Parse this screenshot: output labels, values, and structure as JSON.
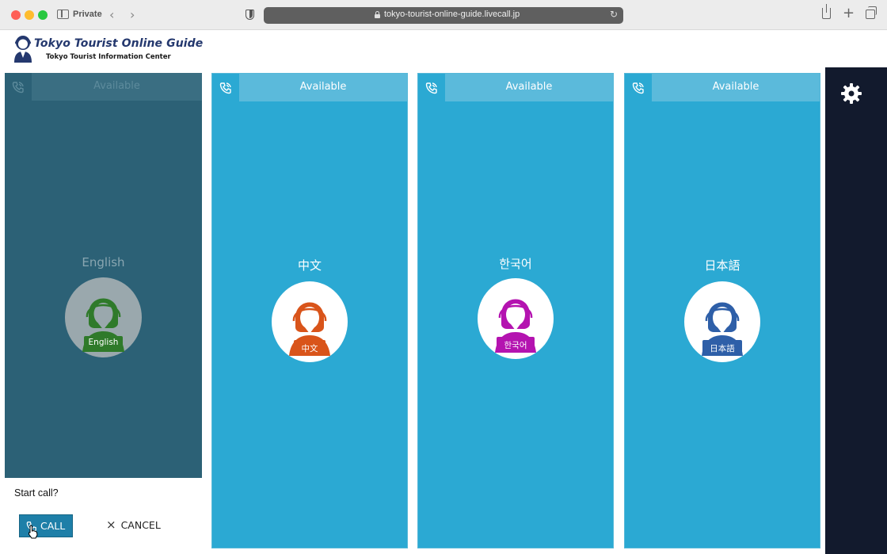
{
  "browser": {
    "private_label": "Private",
    "url": "tokyo-tourist-online-guide.livecall.jp"
  },
  "header": {
    "logo_title": "Tokyo Tourist Online Guide",
    "logo_subtitle": "Tokyo Tourist Information Center"
  },
  "panels": [
    {
      "status": "Available",
      "language": "English",
      "badge": "English",
      "accent": "#2f7a2a",
      "state": "selected"
    },
    {
      "status": "Available",
      "language": "中文",
      "badge": "中文",
      "accent": "#d9541a",
      "state": "normal"
    },
    {
      "status": "Available",
      "language": "한국어",
      "badge": "한국어",
      "accent": "#b413b0",
      "state": "normal"
    },
    {
      "status": "Available",
      "language": "日本語",
      "badge": "日本語",
      "accent": "#2e5fa8",
      "state": "normal"
    }
  ],
  "confirm": {
    "prompt": "Start call?",
    "call_label": "CALL",
    "cancel_label": "CANCEL"
  },
  "colors": {
    "panel_bg": "#2ba9d3",
    "selected_bg": "#2c6176",
    "settings_bg": "#121a2d"
  },
  "icons": {
    "settings": "gear-icon",
    "phone": "phone-icon"
  }
}
